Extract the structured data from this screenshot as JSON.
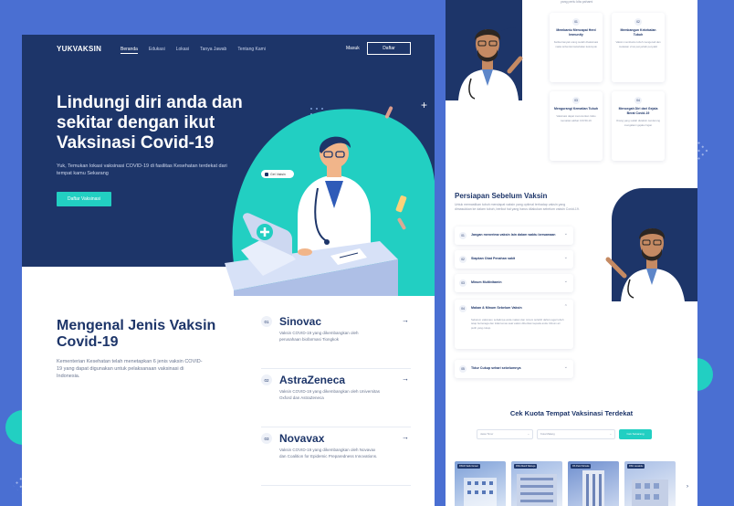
{
  "nav": {
    "logo": "YUKVAKSIN",
    "links": [
      "Beranda",
      "Edukasi",
      "Lokasi",
      "Tanya Jawab",
      "Tentang Kami"
    ],
    "login": "Masuk",
    "register": "Daftar"
  },
  "hero": {
    "title": "Lindungi diri anda dan sekitar dengan ikut Vaksinasi Covid-19",
    "subtitle": "Yuk, Temukan lokasi vaksinasi COVID-19 di fasilitas Kesehatan terdekat dari tempat kamu Sekarang",
    "cta": "Daftar Vaksinasi",
    "badge": "Get Vaksin"
  },
  "vaccine_section": {
    "title": "Mengenal Jenis Vaksin Covid-19",
    "text": "Kementerian Kesehatan telah menetapkan 6 jenis vaksin COVID-19 yang dapat digunakan untuk pelaksanaan vaksinasi di Indonesia.",
    "items": [
      {
        "num": "01",
        "name": "Sinovac",
        "desc": "Vaksin COVID-19 yang dikembangkan oleh perusahaan biofarmasi Tiongkok"
      },
      {
        "num": "02",
        "name": "AstraZeneca",
        "desc": "Vaksin COVID-19 yang dikembangkan oleh Universitas Oxford dan AstraZeneca"
      },
      {
        "num": "03",
        "name": "Novavax",
        "desc": "Vaksin COVID-19 yang dikembangkan oleh Novavax dan Coalition for Epidemic Preparedness Innovations."
      }
    ]
  },
  "right": {
    "top_line": "yang perlu kita pahami",
    "steps": [
      {
        "num": "01",
        "title": "Membantu Mencapai Herd Immunity",
        "text": "Ketika banyak orang sudah divaksinasi maka terbentuk kekebalan kelompok"
      },
      {
        "num": "02",
        "title": "Membangun Kekebalan Tubuh",
        "text": "Vaksin membantu tubuh mengenali dan melawan virus penyebab penyakit"
      },
      {
        "num": "03",
        "title": "Mengurangi Kematian Tubuh",
        "text": "Vaksinasi dapat menurunkan risiko kematian akibat COVID-19"
      },
      {
        "num": "04",
        "title": "Mencegah Diri dari Gejala Berat Covid-19",
        "text": "Orang yang sudah divaksin cenderung mengalami gejala ringan"
      }
    ],
    "prep_title": "Persiapan Sebelum Vaksin",
    "prep_sub": "Untuk memastikan tubuh mendapat vaksin yang optimal terhadap vaksin yang dimasukkan ke dalam tubuh, berikut hal yang harus dilakukan sebelum vaksin Covid-19.",
    "accordion": [
      {
        "num": "01",
        "label": "Jangan menerima vaksin lain dalam waktu bersamaan",
        "body": ""
      },
      {
        "num": "02",
        "label": "Siapkan Obat Penahan sakit",
        "body": ""
      },
      {
        "num": "03",
        "label": "Minum Multivitamin",
        "body": ""
      },
      {
        "num": "04",
        "label": "Makan & Minum Sebelum Vaksin",
        "body": "Sebelum vaksinasi, sebaiknya anda makan dan minum terlebih dahulu agar tubuh tetap bertenaga dan tidak lemas saat vaksin diberikan kepada anda. Minum air putih yang cukup."
      },
      {
        "num": "05",
        "label": "Tidur Cukup sehari sebelumnya",
        "body": ""
      }
    ],
    "cek_title": "Cek Kuota Tempat Vaksinasi Terdekat",
    "cek_province": "Jawa Timur",
    "cek_city": "Kota Malang",
    "cek_button": "Cek Sekarang",
    "places": [
      "RSUD Saiful Anwar",
      "RSIA Mardi Waloeja",
      "RS Panti Nirmala",
      "RSU Lavalette"
    ]
  },
  "colors": {
    "navy": "#1d3569",
    "teal": "#22cfc2",
    "background": "#4a6fd2"
  }
}
